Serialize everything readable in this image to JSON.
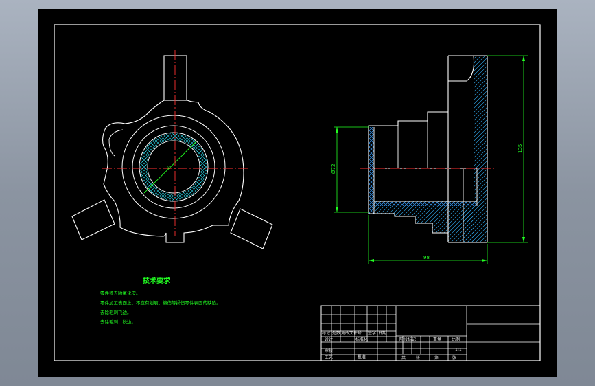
{
  "technical_requirements": {
    "title": "技术要求",
    "notes": [
      "零件须去除氧化皮。",
      "零件加工表面上，不应有划痕、擦伤等损伤零件表面的缺陷。",
      "去除毛刺飞边。",
      "去除毛刺，锐边。"
    ]
  },
  "dimensions": {
    "bore_diameter": "Ø72",
    "height": "135",
    "length": "98"
  },
  "title_block": {
    "labels": {
      "mark": "标记",
      "count": "处数",
      "change_doc": "更改文件号",
      "signature": "签字",
      "date": "日期",
      "designer": "设计",
      "standardization": "标准化",
      "stage_mark": "阶段标记",
      "weight": "重量",
      "scale": "比例",
      "review": "审核",
      "process": "工艺",
      "approval": "批准",
      "sheet_total": "共",
      "sheet": "张",
      "sheet_no": "第"
    },
    "scale_value": "1:1"
  }
}
